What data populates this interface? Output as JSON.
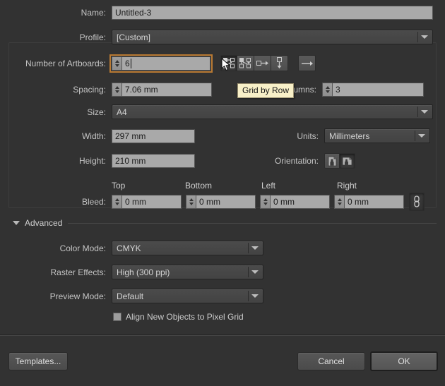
{
  "dialog": {
    "name_label": "Name:",
    "name_value": "Untitled-3",
    "profile_label": "Profile:",
    "profile_value": "[Custom]",
    "artboards_label": "Number of Artboards:",
    "artboards_value": "6",
    "spacing_label": "Spacing:",
    "spacing_value": "7.06 mm",
    "columns_label": "Columns:",
    "columns_value": "3",
    "size_label": "Size:",
    "size_value": "A4",
    "width_label": "Width:",
    "width_value": "297 mm",
    "height_label": "Height:",
    "height_value": "210 mm",
    "units_label": "Units:",
    "units_value": "Millimeters",
    "orientation_label": "Orientation:",
    "bleed_label": "Bleed:",
    "bleed_headers": [
      "Top",
      "Bottom",
      "Left",
      "Right"
    ],
    "bleed_values": [
      "0 mm",
      "0 mm",
      "0 mm",
      "0 mm"
    ],
    "advanced_label": "Advanced",
    "color_mode_label": "Color Mode:",
    "color_mode_value": "CMYK",
    "raster_label": "Raster Effects:",
    "raster_value": "High (300 ppi)",
    "preview_label": "Preview Mode:",
    "preview_value": "Default",
    "align_pixel_label": "Align New Objects to Pixel Grid"
  },
  "tooltip": {
    "text": "Grid by Row"
  },
  "arrange_buttons": [
    {
      "name": "grid-by-row-button",
      "title": "Grid by Row",
      "pressed": true
    },
    {
      "name": "grid-by-column-button",
      "title": "Grid by Column",
      "pressed": false
    },
    {
      "name": "arrange-by-row-button",
      "title": "Arrange by Row",
      "pressed": false
    },
    {
      "name": "arrange-by-column-button",
      "title": "Arrange by Column",
      "pressed": false
    }
  ],
  "flow_direction_button": {
    "name": "left-to-right-flow-button",
    "title": "Left-to-Right Flow"
  },
  "orientation_buttons": [
    {
      "name": "portrait-orientation-button",
      "pressed": false
    },
    {
      "name": "landscape-orientation-button",
      "pressed": true
    }
  ],
  "bleed_link": {
    "name": "link-bleed-values-icon",
    "linked": true
  },
  "footer": {
    "templates_label": "Templates...",
    "cancel_label": "Cancel",
    "ok_label": "OK"
  },
  "colors": {
    "background": "#323232",
    "field_bg": "#a9a9a9",
    "focus_ring": "#b97a33",
    "tooltip_bg": "#f8f0c8",
    "text": "#c8c8c8"
  }
}
